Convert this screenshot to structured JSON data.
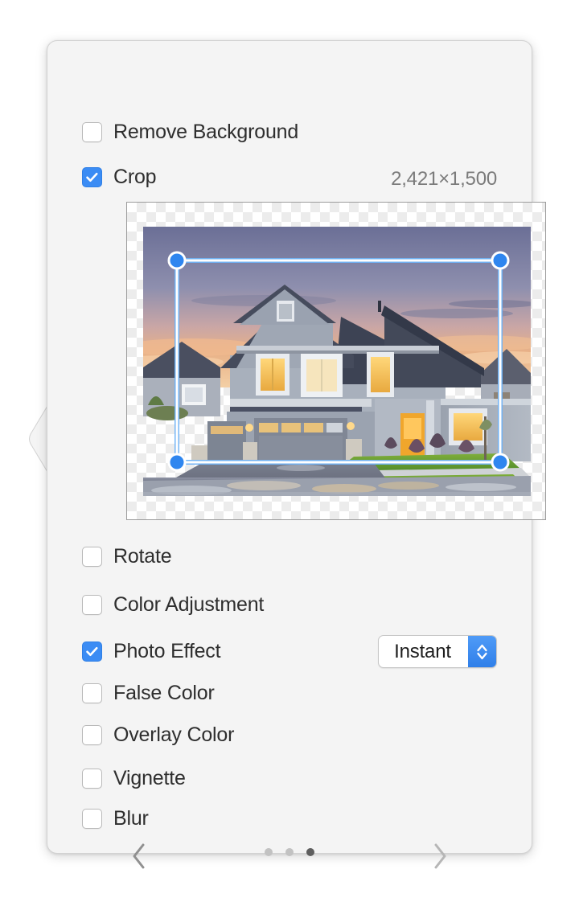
{
  "panel": {
    "dimensions_label": "2,421×1,500",
    "accent_color": "#3b8cf4",
    "background_color": "#f4f4f4"
  },
  "adjustments": [
    {
      "label": "Remove Background",
      "checked": false
    },
    {
      "label": "Crop",
      "checked": true
    },
    {
      "label": "Rotate",
      "checked": false
    },
    {
      "label": "Color Adjustment",
      "checked": false
    },
    {
      "label": "Photo Effect",
      "checked": true
    },
    {
      "label": "False Color",
      "checked": false
    },
    {
      "label": "Overlay Color",
      "checked": false
    },
    {
      "label": "Vignette",
      "checked": false
    },
    {
      "label": "Blur",
      "checked": false
    }
  ],
  "photo_effect": {
    "selected": "Instant",
    "stepper_icon": "chevron-up-down-icon"
  },
  "preview": {
    "alt": "Two-story suburban house at dusk with wet driveway",
    "crop_handles": 4
  },
  "pager": {
    "prev_icon": "chevron-left-icon",
    "next_icon": "chevron-right-icon",
    "total_pages": 3,
    "current_page": 3
  }
}
